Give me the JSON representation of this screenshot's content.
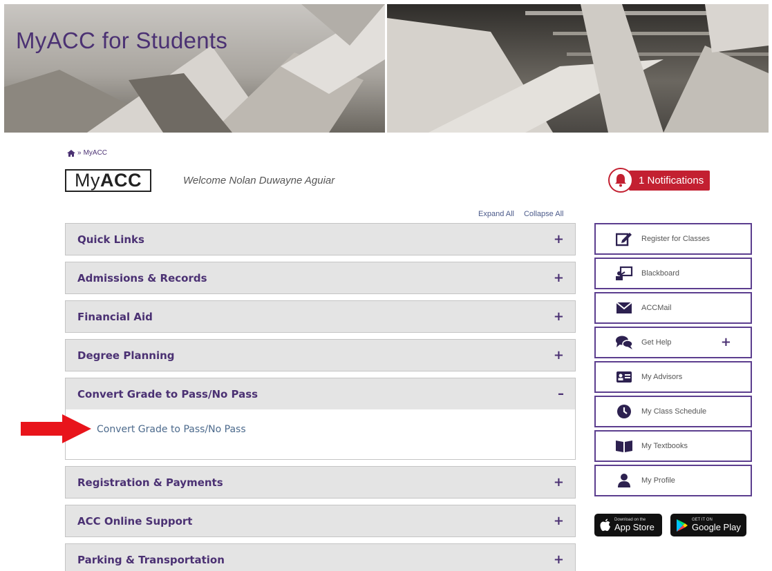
{
  "banner": {
    "title": "MyACC for Students"
  },
  "breadcrumb": {
    "separator": "»",
    "current": "MyACC"
  },
  "header": {
    "logo_plain": "My",
    "logo_bold": "ACC",
    "welcome": "Welcome Nolan Duwayne Aguiar",
    "notifications_label": "1 Notifications"
  },
  "controls": {
    "expand_all": "Expand All",
    "collapse_all": "Collapse All"
  },
  "accordion": {
    "items": [
      {
        "title": "Quick Links",
        "toggle": "+"
      },
      {
        "title": "Admissions & Records",
        "toggle": "+"
      },
      {
        "title": "Financial Aid",
        "toggle": "+"
      },
      {
        "title": "Degree Planning",
        "toggle": "+"
      },
      {
        "title": "Convert Grade to Pass/No Pass",
        "toggle": "–",
        "link": "Convert Grade to Pass/No Pass"
      },
      {
        "title": "Registration & Payments",
        "toggle": "+"
      },
      {
        "title": "ACC Online Support",
        "toggle": "+"
      },
      {
        "title": "Parking & Transportation",
        "toggle": "+"
      }
    ]
  },
  "quick_buttons": [
    {
      "label": "Register for Classes",
      "icon": "edit-icon"
    },
    {
      "label": "Blackboard",
      "icon": "presentation-icon"
    },
    {
      "label": "ACCMail",
      "icon": "envelope-icon"
    },
    {
      "label": "Get Help",
      "icon": "chat-bubbles-icon",
      "plus": "+"
    },
    {
      "label": "My Advisors",
      "icon": "id-card-icon"
    },
    {
      "label": "My Class Schedule",
      "icon": "clock-icon"
    },
    {
      "label": "My Textbooks",
      "icon": "book-icon"
    },
    {
      "label": "My Profile",
      "icon": "user-icon"
    }
  ],
  "badges": {
    "apple": {
      "small": "Download on the",
      "big": "App Store"
    },
    "google": {
      "small": "GET IT ON",
      "big": "Google Play"
    }
  },
  "colors": {
    "brand_purple": "#4b3173",
    "notification_red": "#c32031",
    "arrow_red": "#e8141b"
  }
}
